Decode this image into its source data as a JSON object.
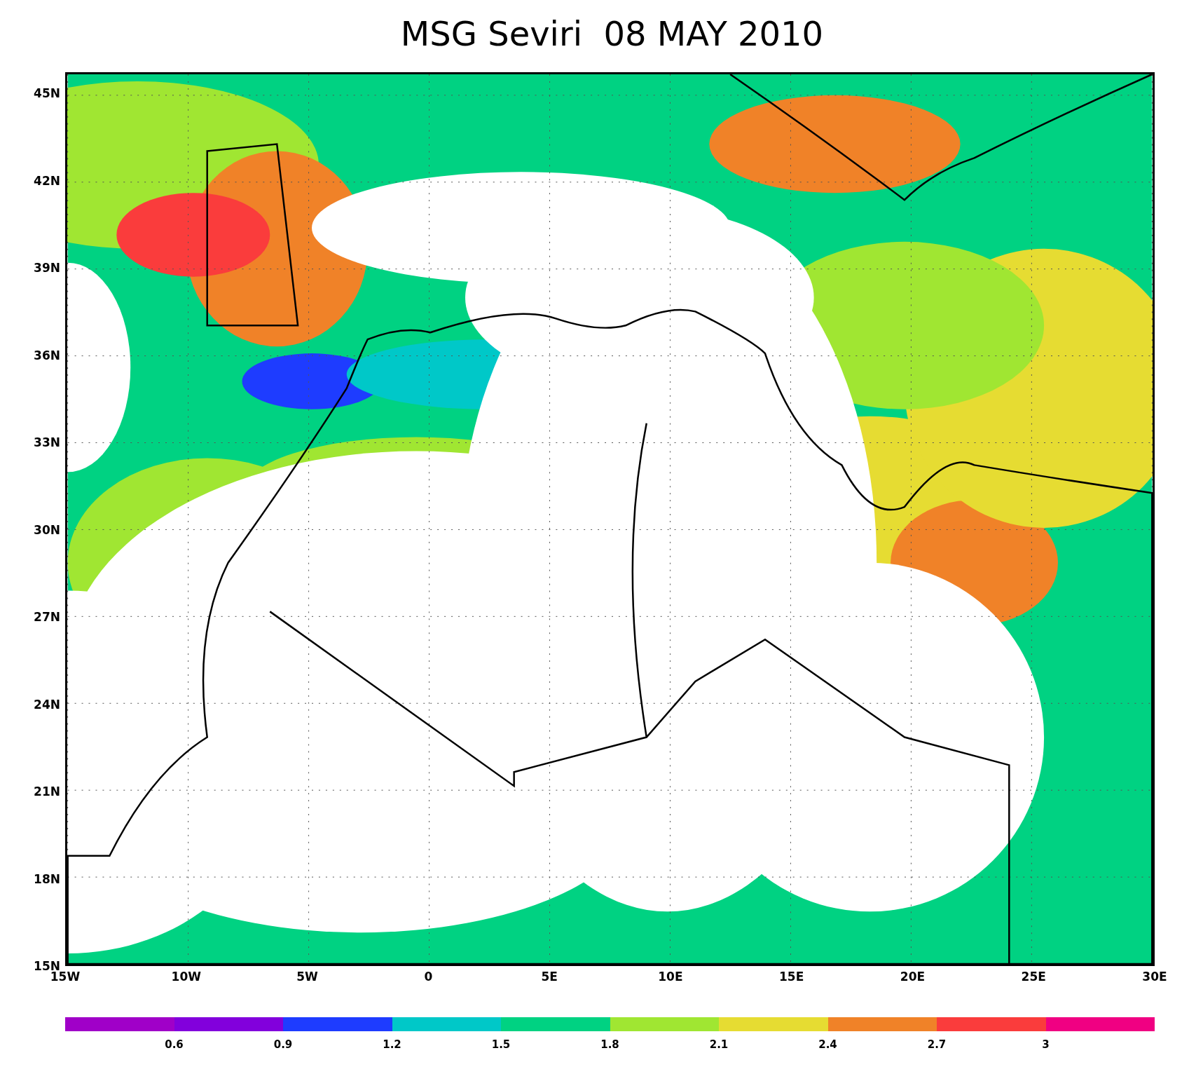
{
  "title": "MSG Seviri  08 MAY 2010",
  "map": {
    "lat_labels": [
      "45N",
      "42N",
      "39N",
      "36N",
      "33N",
      "30N",
      "27N",
      "24N",
      "21N",
      "18N",
      "15N"
    ],
    "lon_labels": [
      "15W",
      "10W",
      "5W",
      "0",
      "5E",
      "10E",
      "15E",
      "20E",
      "25E",
      "30E"
    ]
  },
  "colorbar": {
    "segments": [
      {
        "color": "#a000c8"
      },
      {
        "color": "#8200dc"
      },
      {
        "color": "#1e3cff"
      },
      {
        "color": "#00c8c8"
      },
      {
        "color": "#00d282"
      },
      {
        "color": "#a0e632"
      },
      {
        "color": "#e6dc32"
      },
      {
        "color": "#f08228"
      },
      {
        "color": "#fa3c3c"
      },
      {
        "color": "#f00082"
      }
    ],
    "labels": [
      "0.6",
      "0.9",
      "1.2",
      "1.5",
      "1.8",
      "2.1",
      "2.4",
      "2.7",
      "3"
    ]
  }
}
